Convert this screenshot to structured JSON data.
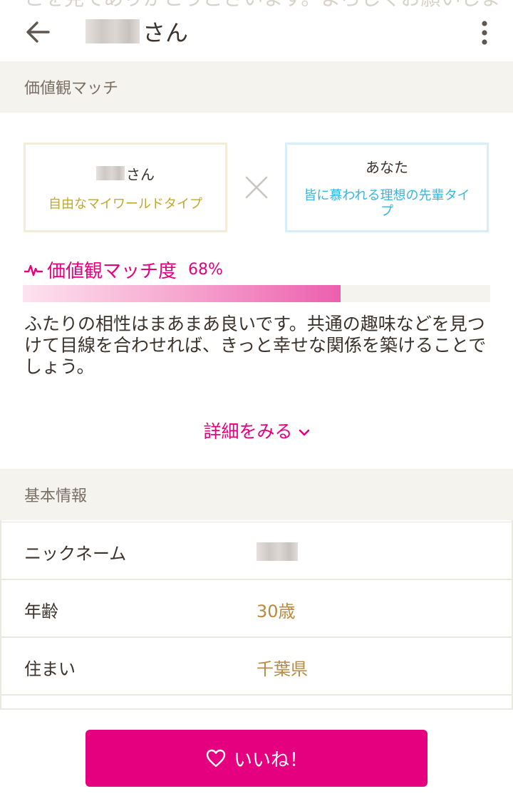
{
  "header": {
    "background_text": "こを見てありがとうございます。よろしくお願いしま",
    "title_suffix": "さん"
  },
  "values_section": {
    "heading": "価値観マッチ",
    "left_box": {
      "name_suffix": "さん",
      "type": "自由なマイワールドタイプ"
    },
    "right_box": {
      "name": "あなた",
      "type": "皆に慕われる理想の先輩タイプ"
    },
    "match_label": "価値観マッチ度",
    "match_percent_text": "68%",
    "match_fraction": 0.68,
    "description": "ふたりの相性はまあまあ良いです。共通の趣味などを見つけて目線を合わせれば、きっと幸せな関係を築けることでしょう。",
    "more_label": "詳細をみる"
  },
  "basic_info": {
    "heading": "基本情報",
    "rows": [
      {
        "label": "ニックネーム",
        "value": ""
      },
      {
        "label": "年齢",
        "value": "30歳"
      },
      {
        "label": "住まい",
        "value": "千葉県"
      }
    ]
  },
  "footer": {
    "like_label": "いいね！"
  },
  "colors": {
    "accent_pink": "#e4007f",
    "left_type": "#c0a733",
    "right_type": "#35b6e0",
    "value_brown": "#b98a3f"
  },
  "icons": [
    "back-arrow-icon",
    "more-vert-icon",
    "cross-icon",
    "pulse-icon",
    "chevron-down-icon",
    "heart-icon"
  ]
}
